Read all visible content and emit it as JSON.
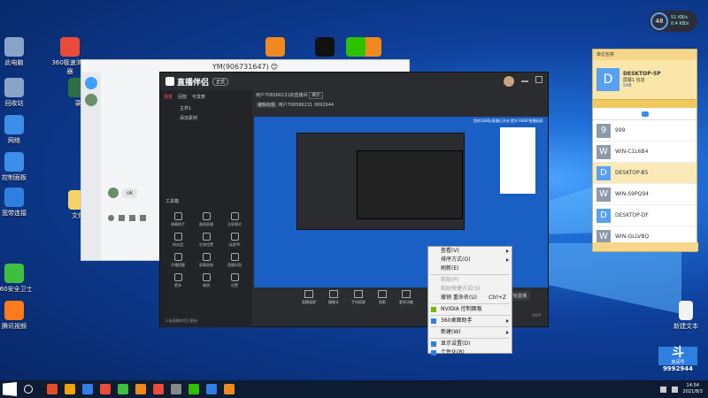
{
  "desktop": {
    "icons_left": [
      {
        "label": "此电脑",
        "color": "#8aa4c8"
      },
      {
        "label": "回收站",
        "color": "#8aa4c8"
      },
      {
        "label": "网络",
        "color": "#3c8ee8"
      },
      {
        "label": "控制面板",
        "color": "#3c8ee8"
      },
      {
        "label": "宽带连接",
        "color": "#2f7fe0"
      },
      {
        "label": "360安全卫士",
        "color": "#3fbf3f"
      },
      {
        "label": "腾讯视频",
        "color": "#ff7a1a"
      }
    ],
    "icons_top": [
      {
        "label": "360极速浏览器",
        "color": "#ea4b3b"
      },
      {
        "label": "直播伴侣",
        "color": "#f08a1e"
      },
      {
        "label": "录",
        "color": "#2d6f45"
      },
      {
        "label": "网易云",
        "color": "#f08a1e"
      },
      {
        "label": "QQ",
        "color": "#111"
      },
      {
        "label": "微信",
        "color": "#2dc100"
      }
    ],
    "icon_folder": {
      "label": "文件"
    },
    "icon_doc_right": {
      "label": "新建文本"
    }
  },
  "chat_window": {
    "title": "YM(906731647)",
    "emoji": "😊",
    "bubble_text": "ok"
  },
  "live_window": {
    "app_title": "直播伴侣",
    "badge": "正式",
    "tabs": [
      "场景",
      "回放",
      "可发表"
    ],
    "user_line": "用户706566131的直播间",
    "status_tag": "娱乐",
    "edit_btn": "编辑标题",
    "room_meta": "用户706566131  9992944",
    "scene_list": [
      "主界1",
      "添加素材"
    ],
    "tools_header": "工具箱",
    "tools": [
      {
        "label": "弹幕助手"
      },
      {
        "label": "截图直播"
      },
      {
        "label": "全屏模式"
      },
      {
        "label": "粉丝团"
      },
      {
        "label": "礼物设置"
      },
      {
        "label": "连麦PK"
      },
      {
        "label": "开播提醒"
      },
      {
        "label": "屏幕录制"
      },
      {
        "label": "直播封面"
      },
      {
        "label": "更多"
      },
      {
        "label": "福袋"
      },
      {
        "label": "设置"
      }
    ],
    "bottom_tools": [
      "直播录屏",
      "摄像头",
      "手机投屏",
      "投影",
      "更多功能"
    ],
    "footer_tip": "3.各直播伴侣已更新",
    "start_btn": "开始直播",
    "resolution": "400P",
    "banner_text": "您的1080p直播已开启 提升1080P直播画质"
  },
  "context_menu": {
    "items": [
      {
        "label": "查看(V)",
        "arrow": true
      },
      {
        "label": "排序方式(O)",
        "arrow": true
      },
      {
        "label": "刷新(E)",
        "arrow": false
      },
      {
        "sep": true
      },
      {
        "label": "粘贴(P)",
        "arrow": false,
        "disabled": true
      },
      {
        "label": "粘贴快捷方式(S)",
        "arrow": false,
        "disabled": true
      },
      {
        "label": "撤销 重命名(U)",
        "shortcut": "Ctrl+Z"
      },
      {
        "sep": true
      },
      {
        "label": "NVIDIA 控制面板",
        "icon_color": "#76b900"
      },
      {
        "sep": true
      },
      {
        "label": "360桌面助手",
        "arrow": true,
        "icon_color": "#2f7fe0"
      },
      {
        "sep": true
      },
      {
        "label": "新建(W)",
        "arrow": true
      },
      {
        "sep": true
      },
      {
        "label": "显示设置(D)",
        "icon_color": "#2f7fe0"
      },
      {
        "label": "个性化(R)",
        "icon_color": "#2f7fe0"
      }
    ]
  },
  "side_panel": {
    "header": "单位名称",
    "profile_name": "DESKTOP-5P",
    "profile_sub": "屏幕1 信息",
    "profile_count": "548",
    "avatar_letter": "D",
    "list": [
      {
        "letter": "9",
        "name": "999",
        "color": "#8e9aab"
      },
      {
        "letter": "W",
        "name": "WIN-C1L6B4",
        "color": "#8e9aab"
      },
      {
        "letter": "D",
        "name": "DESKTOP-B5",
        "color": "#5aa0f0",
        "selected": true
      },
      {
        "letter": "W",
        "name": "WIN-S9PQ94",
        "color": "#8e9aab"
      },
      {
        "letter": "D",
        "name": "DESKTOP-DF",
        "color": "#5aa0f0"
      },
      {
        "letter": "W",
        "name": "WIN-GLLVBQ",
        "color": "#8e9aab"
      }
    ]
  },
  "net_widget": {
    "percent": "48",
    "up": "51 KB/s",
    "down": "0.4 KB/s"
  },
  "watermark": {
    "title": "房间号",
    "room_id": "9992944",
    "logo": "斗"
  },
  "taskbar": {
    "time": "14:54",
    "date": "2021/8/3",
    "pinned_colors": [
      "#e34f26",
      "#f0a30a",
      "#2f7fe0",
      "#ea4b3b",
      "#3fbf3f",
      "#f08a1e",
      "#ea4b3b",
      "#888",
      "#2dc100",
      "#2f7fe0",
      "#f08a1e"
    ]
  }
}
